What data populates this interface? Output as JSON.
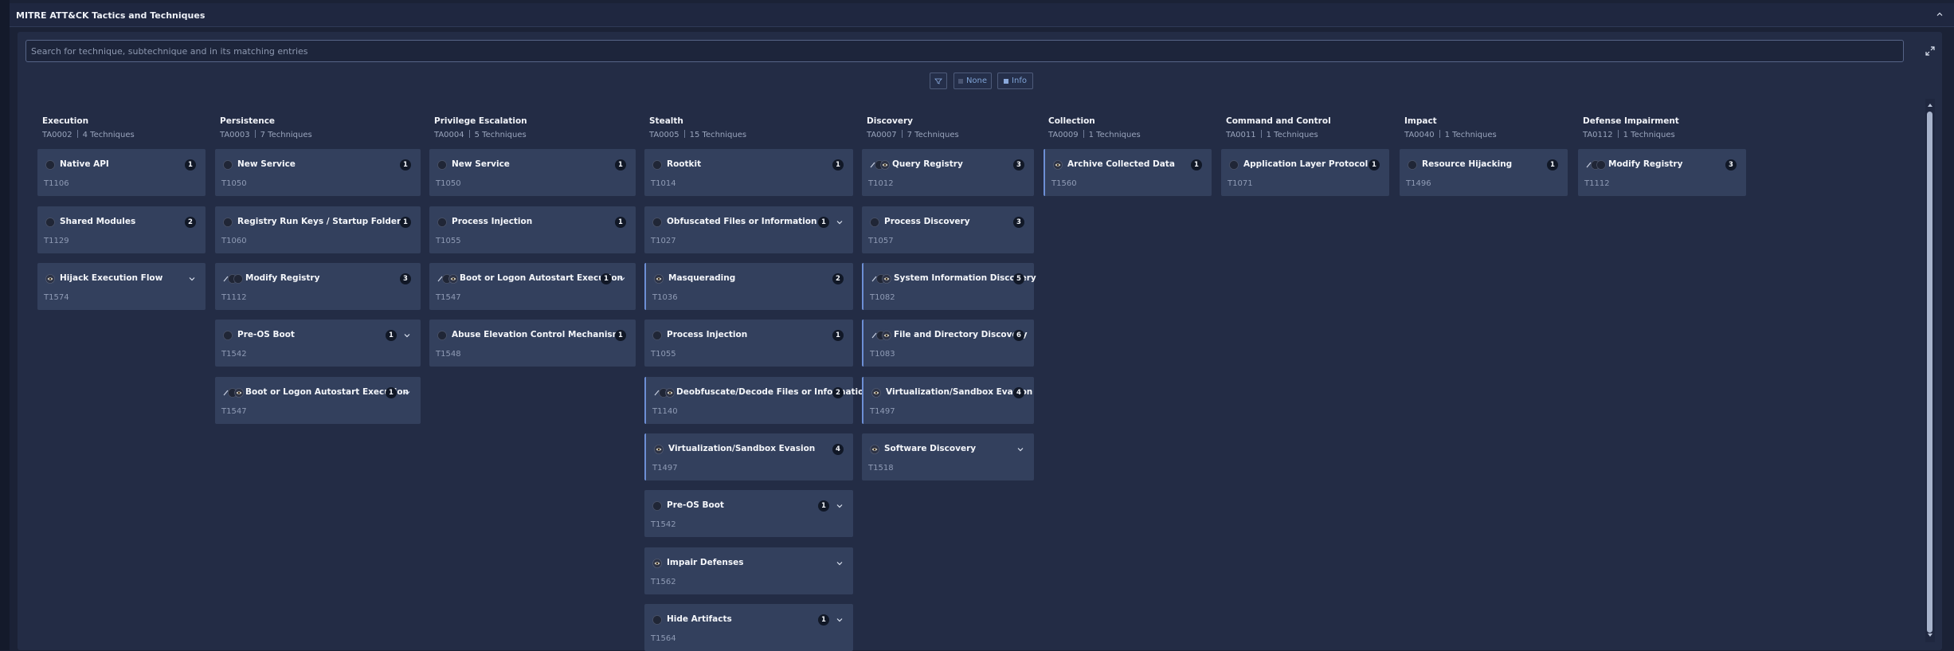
{
  "header": {
    "title": "MITRE ATT&CK Tactics and Techniques"
  },
  "search": {
    "placeholder": "Search for technique, subtechnique and in its matching entries",
    "value": ""
  },
  "filters": {
    "none_label": "None",
    "info_label": "Info",
    "none_color": "#4a5572",
    "info_color": "#8aa8db"
  },
  "colors": {
    "accent": "#6d8fd5",
    "card": "#33405d",
    "panel": "#232c45"
  },
  "tactics": [
    {
      "name": "Execution",
      "id": "TA0002",
      "count": "4 Techniques",
      "techniques": [
        {
          "name": "Native API",
          "id": "T1106",
          "count": "1",
          "expand": false,
          "accent": false,
          "icons": "dot"
        },
        {
          "name": "Shared Modules",
          "id": "T1129",
          "count": "2",
          "expand": false,
          "accent": false,
          "icons": "dot"
        },
        {
          "name": "Hijack Execution Flow",
          "id": "T1574",
          "count": "",
          "expand": true,
          "accent": false,
          "icons": "eye"
        }
      ]
    },
    {
      "name": "Persistence",
      "id": "TA0003",
      "count": "7 Techniques",
      "techniques": [
        {
          "name": "New Service",
          "id": "T1050",
          "count": "1",
          "expand": false,
          "accent": false,
          "icons": "dot"
        },
        {
          "name": "Registry Run Keys / Startup Folder",
          "id": "T1060",
          "count": "1",
          "expand": false,
          "accent": false,
          "icons": "dot"
        },
        {
          "name": "Modify Registry",
          "id": "T1112",
          "count": "3",
          "expand": false,
          "accent": false,
          "icons": "multi-dots"
        },
        {
          "name": "Pre-OS Boot",
          "id": "T1542",
          "count": "1",
          "expand": true,
          "accent": false,
          "icons": "dot"
        },
        {
          "name": "Boot or Logon Autostart Execution",
          "id": "T1547",
          "count": "1",
          "expand": true,
          "accent": false,
          "icons": "dot-eye"
        }
      ]
    },
    {
      "name": "Privilege Escalation",
      "id": "TA0004",
      "count": "5 Techniques",
      "techniques": [
        {
          "name": "New Service",
          "id": "T1050",
          "count": "1",
          "expand": false,
          "accent": false,
          "icons": "dot"
        },
        {
          "name": "Process Injection",
          "id": "T1055",
          "count": "1",
          "expand": false,
          "accent": false,
          "icons": "dot"
        },
        {
          "name": "Boot or Logon Autostart Execution",
          "id": "T1547",
          "count": "1",
          "expand": true,
          "accent": false,
          "icons": "dot-eye"
        },
        {
          "name": "Abuse Elevation Control Mechanism",
          "id": "T1548",
          "count": "1",
          "expand": false,
          "accent": false,
          "icons": "dot"
        }
      ]
    },
    {
      "name": "Stealth",
      "id": "TA0005",
      "count": "15 Techniques",
      "techniques": [
        {
          "name": "Rootkit",
          "id": "T1014",
          "count": "1",
          "expand": false,
          "accent": false,
          "icons": "dot"
        },
        {
          "name": "Obfuscated Files or Information",
          "id": "T1027",
          "count": "1",
          "expand": true,
          "accent": false,
          "icons": "dot"
        },
        {
          "name": "Masquerading",
          "id": "T1036",
          "count": "2",
          "expand": false,
          "accent": true,
          "icons": "eye"
        },
        {
          "name": "Process Injection",
          "id": "T1055",
          "count": "1",
          "expand": false,
          "accent": false,
          "icons": "dot"
        },
        {
          "name": "Deobfuscate/Decode Files or Information",
          "id": "T1140",
          "count": "2",
          "expand": false,
          "accent": true,
          "icons": "dot-eye"
        },
        {
          "name": "Virtualization/Sandbox Evasion",
          "id": "T1497",
          "count": "4",
          "expand": false,
          "accent": true,
          "icons": "eye"
        },
        {
          "name": "Pre-OS Boot",
          "id": "T1542",
          "count": "1",
          "expand": true,
          "accent": false,
          "icons": "dot"
        },
        {
          "name": "Impair Defenses",
          "id": "T1562",
          "count": "",
          "expand": true,
          "accent": false,
          "icons": "eye"
        },
        {
          "name": "Hide Artifacts",
          "id": "T1564",
          "count": "1",
          "expand": true,
          "accent": false,
          "icons": "dot"
        }
      ]
    },
    {
      "name": "Discovery",
      "id": "TA0007",
      "count": "7 Techniques",
      "techniques": [
        {
          "name": "Query Registry",
          "id": "T1012",
          "count": "3",
          "expand": false,
          "accent": false,
          "icons": "multi-eye"
        },
        {
          "name": "Process Discovery",
          "id": "T1057",
          "count": "3",
          "expand": false,
          "accent": false,
          "icons": "dot"
        },
        {
          "name": "System Information Discovery",
          "id": "T1082",
          "count": "5",
          "expand": false,
          "accent": true,
          "icons": "multi-eye"
        },
        {
          "name": "File and Directory Discovery",
          "id": "T1083",
          "count": "6",
          "expand": false,
          "accent": true,
          "icons": "multi-eye"
        },
        {
          "name": "Virtualization/Sandbox Evasion",
          "id": "T1497",
          "count": "4",
          "expand": false,
          "accent": true,
          "icons": "eye"
        },
        {
          "name": "Software Discovery",
          "id": "T1518",
          "count": "",
          "expand": true,
          "accent": false,
          "icons": "eye"
        }
      ]
    },
    {
      "name": "Collection",
      "id": "TA0009",
      "count": "1 Techniques",
      "techniques": [
        {
          "name": "Archive Collected Data",
          "id": "T1560",
          "count": "1",
          "expand": false,
          "accent": true,
          "icons": "eye"
        }
      ]
    },
    {
      "name": "Command and Control",
      "id": "TA0011",
      "count": "1 Techniques",
      "techniques": [
        {
          "name": "Application Layer Protocol",
          "id": "T1071",
          "count": "1",
          "expand": false,
          "accent": false,
          "icons": "dot"
        }
      ]
    },
    {
      "name": "Impact",
      "id": "TA0040",
      "count": "1 Techniques",
      "techniques": [
        {
          "name": "Resource Hijacking",
          "id": "T1496",
          "count": "1",
          "expand": false,
          "accent": false,
          "icons": "dot"
        }
      ]
    },
    {
      "name": "Defense Impairment",
      "id": "TA0112",
      "count": "1 Techniques",
      "techniques": [
        {
          "name": "Modify Registry",
          "id": "T1112",
          "count": "3",
          "expand": false,
          "accent": false,
          "icons": "multi-dots"
        }
      ]
    }
  ]
}
